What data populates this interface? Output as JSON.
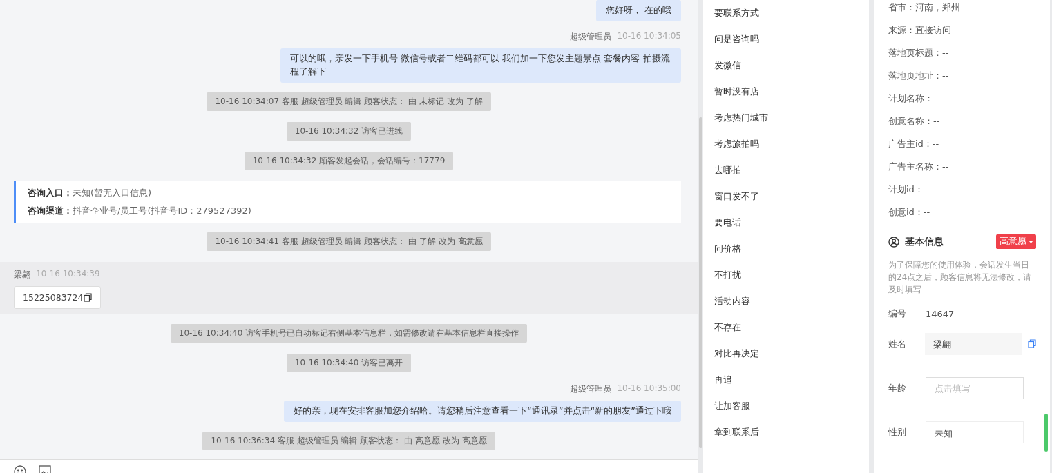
{
  "chat": {
    "messages": [
      {
        "kind": "agent",
        "text": "您好呀， 在的哦"
      },
      {
        "kind": "agent",
        "name": "超级管理员",
        "time": "10-16 10:34:05",
        "text": "可以的哦，亲发一下手机号 微信号或者二维码都可以 我们加一下您发主题景点 套餐内容 拍摄流程了解下"
      },
      {
        "kind": "system",
        "text": "10-16 10:34:07 客服 超级管理员 编辑 顾客状态： 由 未标记 改为 了解"
      },
      {
        "kind": "system",
        "text": "10-16 10:34:32 访客已进线"
      },
      {
        "kind": "system",
        "text": "10-16 10:34:32 顾客发起会话，会话编号：17779"
      },
      {
        "kind": "info",
        "lines": [
          {
            "label": "咨询入口：",
            "value": "未知(暂无入口信息)"
          },
          {
            "label": "咨询渠道：",
            "value": "抖音企业号/员工号(抖音号ID：279527392)"
          }
        ]
      },
      {
        "kind": "system",
        "text": "10-16 10:34:41 客服 超级管理员 编辑 顾客状态： 由 了解 改为 高意愿"
      },
      {
        "kind": "visitor",
        "name": "梁翩",
        "time": "10-16 10:34:39",
        "text": "15225083724"
      },
      {
        "kind": "system",
        "text": "10-16 10:34:40 访客手机号已自动标记右侧基本信息栏，如需修改请在基本信息栏直接操作"
      },
      {
        "kind": "system",
        "text": "10-16 10:34:40 访客已离开"
      },
      {
        "kind": "agent",
        "name": "超级管理员",
        "time": "10-16 10:35:00",
        "text": "好的亲，现在安排客服加您介绍哈。请您稍后注意查看一下“通讯录”并点击“新的朋友”通过下哦"
      },
      {
        "kind": "system",
        "text": "10-16 10:36:34 客服 超级管理员 编辑 顾客状态： 由 高意愿 改为 高意愿"
      }
    ]
  },
  "quick_replies": [
    "要联系方式",
    "问是咨询吗",
    "发微信",
    "暂时没有店",
    "考虑热门城市",
    "考虑旅拍吗",
    "去哪拍",
    "窗口发不了",
    "要电话",
    "问价格",
    "不打扰",
    "活动内容",
    "不存在",
    "对比再决定",
    "再追",
    "让加客服",
    "拿到联系后"
  ],
  "visitor_info": {
    "rows": [
      "省市：河南，郑州",
      "来源：直接访问",
      "落地页标题：--",
      "落地页地址：--",
      "计划名称：--",
      "创意名称：--",
      "广告主id：--",
      "广告主名称：--",
      "计划id：--",
      "创意id：--"
    ]
  },
  "basic_info": {
    "title": "基本信息",
    "status": "高意愿",
    "notice": "为了保障您的使用体验，会话发生当日的24点之后，顾客信息将无法修改，请及时填写",
    "fields": [
      {
        "kind": "text",
        "label": "编号",
        "value": "14647"
      },
      {
        "kind": "filled",
        "label": "姓名",
        "value": "梁翩"
      },
      {
        "kind": "input",
        "label": "年龄",
        "placeholder": "点击填写"
      },
      {
        "kind": "select",
        "label": "性别",
        "value": "未知"
      }
    ]
  }
}
